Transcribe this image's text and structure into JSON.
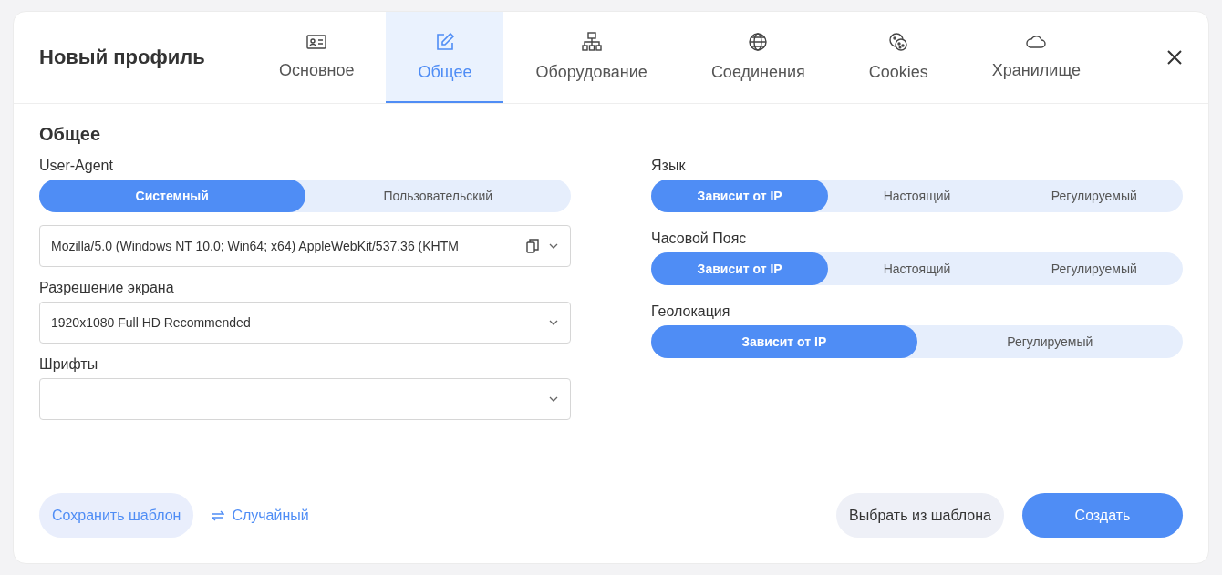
{
  "dialog": {
    "title": "Новый профиль"
  },
  "tabs": [
    {
      "label": "Основное",
      "kind": "id-card",
      "selected": false
    },
    {
      "label": "Общее",
      "kind": "edit",
      "selected": true
    },
    {
      "label": "Оборудование",
      "kind": "network",
      "selected": false
    },
    {
      "label": "Соединения",
      "kind": "globe",
      "selected": false
    },
    {
      "label": "Cookies",
      "kind": "cookie",
      "selected": false
    },
    {
      "label": "Хранилище",
      "kind": "cloud",
      "selected": false
    }
  ],
  "section_title": "Общее",
  "left": [
    {
      "kind": "segmented",
      "label": "User-Agent",
      "options": [
        {
          "label": "Системный",
          "selected": true
        },
        {
          "label": "Пользовательский",
          "selected": false
        }
      ]
    },
    {
      "kind": "select",
      "value": "Mozilla/5.0 (Windows NT 10.0; Win64; x64) AppleWebKit/537.36 (KHTM",
      "copyable": true
    },
    {
      "kind": "select",
      "label": "Разрешение экрана",
      "value": "1920x1080 Full HD Recommended",
      "copyable": false
    },
    {
      "kind": "select",
      "label": "Шрифты",
      "copyable": false
    }
  ],
  "right": [
    {
      "kind": "segmented",
      "label": "Язык",
      "options": [
        {
          "label": "Зависит от IP",
          "selected": true
        },
        {
          "label": "Настоящий",
          "selected": false
        },
        {
          "label": "Регулируемый",
          "selected": false
        }
      ]
    },
    {
      "kind": "segmented",
      "label": "Часовой Пояс",
      "options": [
        {
          "label": "Зависит от IP",
          "selected": true
        },
        {
          "label": "Настоящий",
          "selected": false
        },
        {
          "label": "Регулируемый",
          "selected": false
        }
      ]
    },
    {
      "kind": "segmented",
      "label": "Геолокация",
      "options": [
        {
          "label": "Зависит от IP",
          "selected": true
        },
        {
          "label": "Регулируемый",
          "selected": false
        }
      ]
    }
  ],
  "footer": {
    "save_template": "Сохранить шаблон",
    "random": "Случайный",
    "choose_template": "Выбрать из шаблона",
    "create": "Создать"
  }
}
